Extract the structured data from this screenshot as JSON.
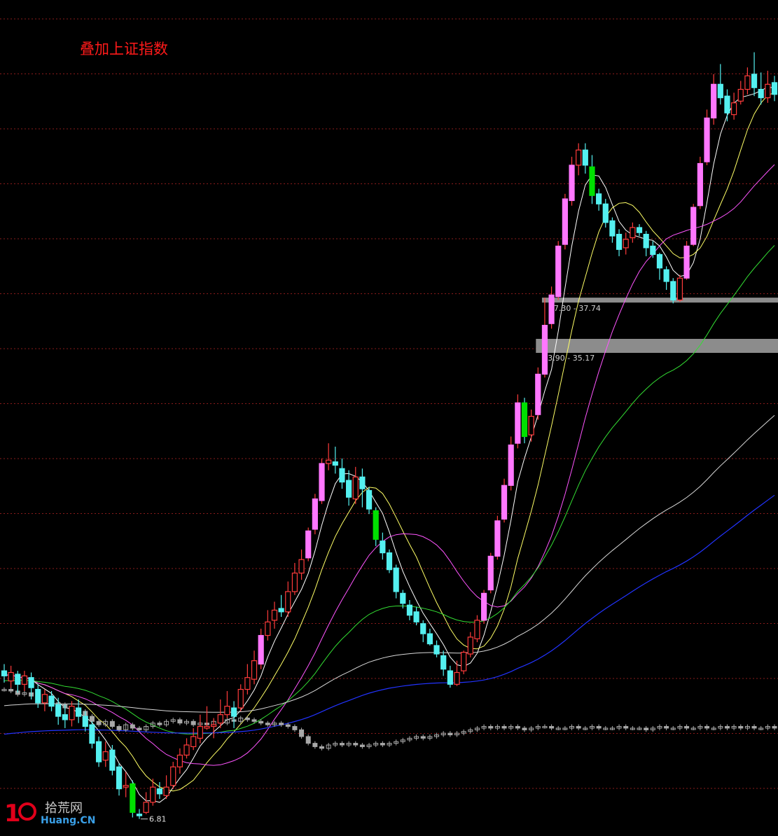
{
  "overlay_label": "叠加上证指数",
  "watermark": {
    "cn": "拾荒网",
    "en": "Huang.CN"
  },
  "colors": {
    "background": "#000000",
    "grid": "#8a1b1b",
    "up": "#ff3b3b",
    "down": "#54f0f0",
    "up_big": "#ff77ff",
    "down_big": "#00e000",
    "index": "#a8a8a8",
    "ma5": "#ffffff",
    "ma10": "#ffff66",
    "ma20": "#ff55ff",
    "ma60": "#33dd33",
    "ma120": "#d8d8d8",
    "ma250": "#2233ff",
    "zone": "#8c8c8c"
  },
  "chart_data": {
    "type": "candlestick",
    "title": "叠加上证指数",
    "ylim": [
      5.8,
      55.4
    ],
    "price_zones": [
      {
        "label": "37.30 - 37.74",
        "low": 37.3,
        "high": 37.74
      },
      {
        "label": "33.90 - 35.17",
        "low": 33.9,
        "high": 35.17
      }
    ],
    "low_marker": {
      "label": "6.81",
      "value": 6.81
    },
    "candles": [
      [
        15.6,
        15.3,
        16,
        14.9
      ],
      [
        15,
        15.5,
        15.9,
        14.6
      ],
      [
        15.4,
        14.8,
        15.6,
        14.3
      ],
      [
        14.8,
        15.3,
        15.6,
        14.4
      ],
      [
        15.2,
        14.6,
        15.5,
        13.9
      ],
      [
        14.5,
        13.7,
        14.8,
        13.4
      ],
      [
        13.7,
        14.2,
        14.5,
        13.2
      ],
      [
        14.1,
        13.5,
        14.4,
        13.2
      ],
      [
        13.6,
        12.9,
        14,
        12.4
      ],
      [
        13,
        12.7,
        13.6,
        12.2
      ],
      [
        12.7,
        13.5,
        13.8,
        12.3
      ],
      [
        13.4,
        12.9,
        13.9,
        12.5
      ],
      [
        12.9,
        12.3,
        13.2,
        12
      ],
      [
        12.4,
        11.3,
        12.6,
        11
      ],
      [
        11.4,
        10.2,
        11.7,
        9.9
      ],
      [
        10.3,
        10.8,
        11.4,
        9.9
      ],
      [
        10.9,
        9.7,
        11.2,
        9.4
      ],
      [
        9.9,
        8.6,
        10.1,
        8.2
      ],
      [
        8.7,
        8.8,
        9.6,
        8.1
      ],
      [
        8.9,
        7.2,
        9.1,
        6.9
      ],
      [
        7.1,
        7,
        7.4,
        6.81
      ],
      [
        7.2,
        7.8,
        8.4,
        7.1
      ],
      [
        7.8,
        8.7,
        9.2,
        7.6
      ],
      [
        8.6,
        8.3,
        9,
        8
      ],
      [
        8.2,
        8.7,
        9.4,
        8
      ],
      [
        8.8,
        9.9,
        10.2,
        8.6
      ],
      [
        9.9,
        10.6,
        11,
        9.5
      ],
      [
        10.6,
        11.2,
        11.6,
        10.4
      ],
      [
        11.1,
        11.7,
        12.2,
        10.9
      ],
      [
        11.6,
        12.3,
        13,
        11.3
      ],
      [
        12.2,
        12.3,
        13.5,
        12.1
      ],
      [
        12.3,
        12.4,
        12.8,
        11.6
      ],
      [
        12.5,
        13,
        13.9,
        12.2
      ],
      [
        13,
        13.5,
        14.4,
        12.8
      ],
      [
        13.4,
        12.9,
        13.8,
        12.2
      ],
      [
        13.4,
        14.5,
        14.8,
        13.2
      ],
      [
        14.5,
        15.2,
        16,
        14.2
      ],
      [
        15.1,
        16.2,
        16.8,
        14.8
      ],
      [
        16,
        17.7,
        18.1,
        15.7
      ],
      [
        17.7,
        18.5,
        19.2,
        17.4
      ],
      [
        18.6,
        19.2,
        19.7,
        18.1
      ],
      [
        19.3,
        19.1,
        20.1,
        18.8
      ],
      [
        19.1,
        20.3,
        20.9,
        18.8
      ],
      [
        20.3,
        21.4,
        22,
        20.1
      ],
      [
        21.4,
        22.2,
        22.8,
        21
      ],
      [
        22.3,
        23.9,
        24.1,
        22.1
      ],
      [
        24,
        25.8,
        26.1,
        23.7
      ],
      [
        25.7,
        27.9,
        28.2,
        25.5
      ],
      [
        27.9,
        28.1,
        29.1,
        27.5
      ],
      [
        28,
        27.8,
        28.9,
        27.3
      ],
      [
        27.6,
        26.8,
        28.2,
        26.4
      ],
      [
        26.9,
        25.9,
        27.5,
        25.4
      ],
      [
        25.8,
        27.1,
        27.7,
        25.5
      ],
      [
        27.1,
        26.4,
        27.6,
        25.3
      ],
      [
        26.3,
        25.2,
        26.5,
        24.9
      ],
      [
        25.1,
        23.4,
        25.3,
        23
      ],
      [
        23.3,
        22.6,
        23.8,
        22.2
      ],
      [
        22.6,
        21.6,
        22.8,
        21.4
      ],
      [
        21.7,
        20.3,
        21.9,
        19.9
      ],
      [
        20.2,
        19.6,
        20.4,
        19.3
      ],
      [
        19.5,
        18.9,
        19.8,
        18.6
      ],
      [
        19.1,
        18.5,
        19.4,
        18.3
      ],
      [
        18.4,
        17.8,
        18.6,
        17.3
      ],
      [
        17.8,
        17.2,
        18.1,
        17.1
      ],
      [
        17.1,
        16.6,
        17.4,
        16.4
      ],
      [
        16.5,
        15.7,
        16.8,
        15.3
      ],
      [
        15.6,
        14.8,
        15.9,
        14.6
      ],
      [
        14.8,
        15.5,
        16.2,
        14.7
      ],
      [
        15.6,
        16.7,
        16.8,
        15.4
      ],
      [
        16.6,
        17.6,
        17.9,
        16.4
      ],
      [
        17.5,
        18.6,
        18.9,
        17.3
      ],
      [
        18.6,
        20.2,
        20.4,
        18.4
      ],
      [
        20.4,
        22.4,
        22.6,
        20.2
      ],
      [
        22.4,
        24.5,
        24.8,
        22.2
      ],
      [
        24.6,
        26.6,
        27,
        24.4
      ],
      [
        26.6,
        29,
        29.5,
        26.3
      ],
      [
        29.1,
        31.5,
        32,
        28.8
      ],
      [
        31.5,
        29.5,
        31.8,
        29.1
      ],
      [
        29.6,
        30.7,
        31.1,
        29.2
      ],
      [
        30.8,
        33.2,
        33.6,
        30.5
      ],
      [
        33.2,
        36.1,
        37.74,
        33
      ],
      [
        36.2,
        37.9,
        38.4,
        35.9
      ],
      [
        37.8,
        40.8,
        41.1,
        37.6
      ],
      [
        40.9,
        43.6,
        43.9,
        40.6
      ],
      [
        43.5,
        45.6,
        46.1,
        43.2
      ],
      [
        45.6,
        46.5,
        46.9,
        45
      ],
      [
        46.5,
        45.6,
        46.9,
        45.1
      ],
      [
        45.5,
        43.8,
        46.2,
        43.3
      ],
      [
        43.9,
        43.3,
        44.2,
        42.9
      ],
      [
        43.3,
        42.2,
        43.6,
        41.9
      ],
      [
        42.3,
        41.4,
        42.5,
        41
      ],
      [
        41.5,
        40.6,
        41.8,
        40.2
      ],
      [
        40.7,
        41.2,
        41.6,
        40.3
      ],
      [
        41.3,
        41.9,
        42.2,
        41
      ],
      [
        41.9,
        41.6,
        42.1,
        41.4
      ],
      [
        41.5,
        40.7,
        41.7,
        40.2
      ],
      [
        40.8,
        40.3,
        41.1,
        40.1
      ],
      [
        40.3,
        39.5,
        40.4,
        38.8
      ],
      [
        39.4,
        38.7,
        39.6,
        38.2
      ],
      [
        38.7,
        37.6,
        38.9,
        37.4
      ],
      [
        37.6,
        38.9,
        39.1,
        37.5
      ],
      [
        38.9,
        40.8,
        41.1,
        38.8
      ],
      [
        40.9,
        43.1,
        43.3,
        40.8
      ],
      [
        43.2,
        45.7,
        46.1,
        43
      ],
      [
        45.8,
        48.4,
        48.9,
        45.6
      ],
      [
        48.4,
        50.4,
        51,
        48
      ],
      [
        50.4,
        49.6,
        51.6,
        49.2
      ],
      [
        49.7,
        48.7,
        50.1,
        48.2
      ],
      [
        48.6,
        49.3,
        49.9,
        48.3
      ],
      [
        49.4,
        50.1,
        50.6,
        49.2
      ],
      [
        50.1,
        50.9,
        51.4,
        49.8
      ],
      [
        51,
        50.2,
        52.3,
        49.7
      ],
      [
        50.1,
        49.6,
        51.1,
        49.2
      ],
      [
        49.6,
        50.4,
        51.2,
        49.3
      ],
      [
        50.5,
        49.8,
        50.9,
        49.4
      ]
    ],
    "index_overlay": [
      14.5,
      14.4,
      14.2,
      14.3,
      14.1,
      13.9,
      13.8,
      13.7,
      13.6,
      13.4,
      13.3,
      13.2,
      12.9,
      12.6,
      12.4,
      12.6,
      12.3,
      12.1,
      12.4,
      12.2,
      12.1,
      12.3,
      12.5,
      12.4,
      12.6,
      12.7,
      12.5,
      12.6,
      12.4,
      12.5,
      12.4,
      12.6,
      12.5,
      12.7,
      12.6,
      12.8,
      12.7,
      12.6,
      12.5,
      12.4,
      12.5,
      12.4,
      12.3,
      12.1,
      11.7,
      11.3,
      11.1,
      11.0,
      11.2,
      11.3,
      11.2,
      11.3,
      11.2,
      11.1,
      11.2,
      11.3,
      11.2,
      11.3,
      11.4,
      11.5,
      11.6,
      11.7,
      11.6,
      11.7,
      11.8,
      11.9,
      11.8,
      11.9,
      12.0,
      12.1,
      12.2,
      12.3,
      12.2,
      12.3,
      12.2,
      12.3,
      12.2,
      12.1,
      12.2,
      12.3,
      12.3,
      12.2,
      12.2,
      12.2,
      12.3,
      12.2,
      12.2,
      12.3,
      12.2,
      12.2,
      12.2,
      12.3,
      12.2,
      12.2,
      12.2,
      12.1,
      12.2,
      12.3,
      12.2,
      12.2,
      12.3,
      12.2,
      12.2,
      12.3,
      12.2,
      12.2,
      12.3,
      12.2,
      12.3,
      12.2,
      12.3,
      12.2,
      12.2,
      12.3,
      12.2,
      12.2
    ],
    "moving_averages": [
      5,
      10,
      20,
      60,
      120,
      250
    ],
    "ma250_start": 11.8,
    "grid": true
  }
}
